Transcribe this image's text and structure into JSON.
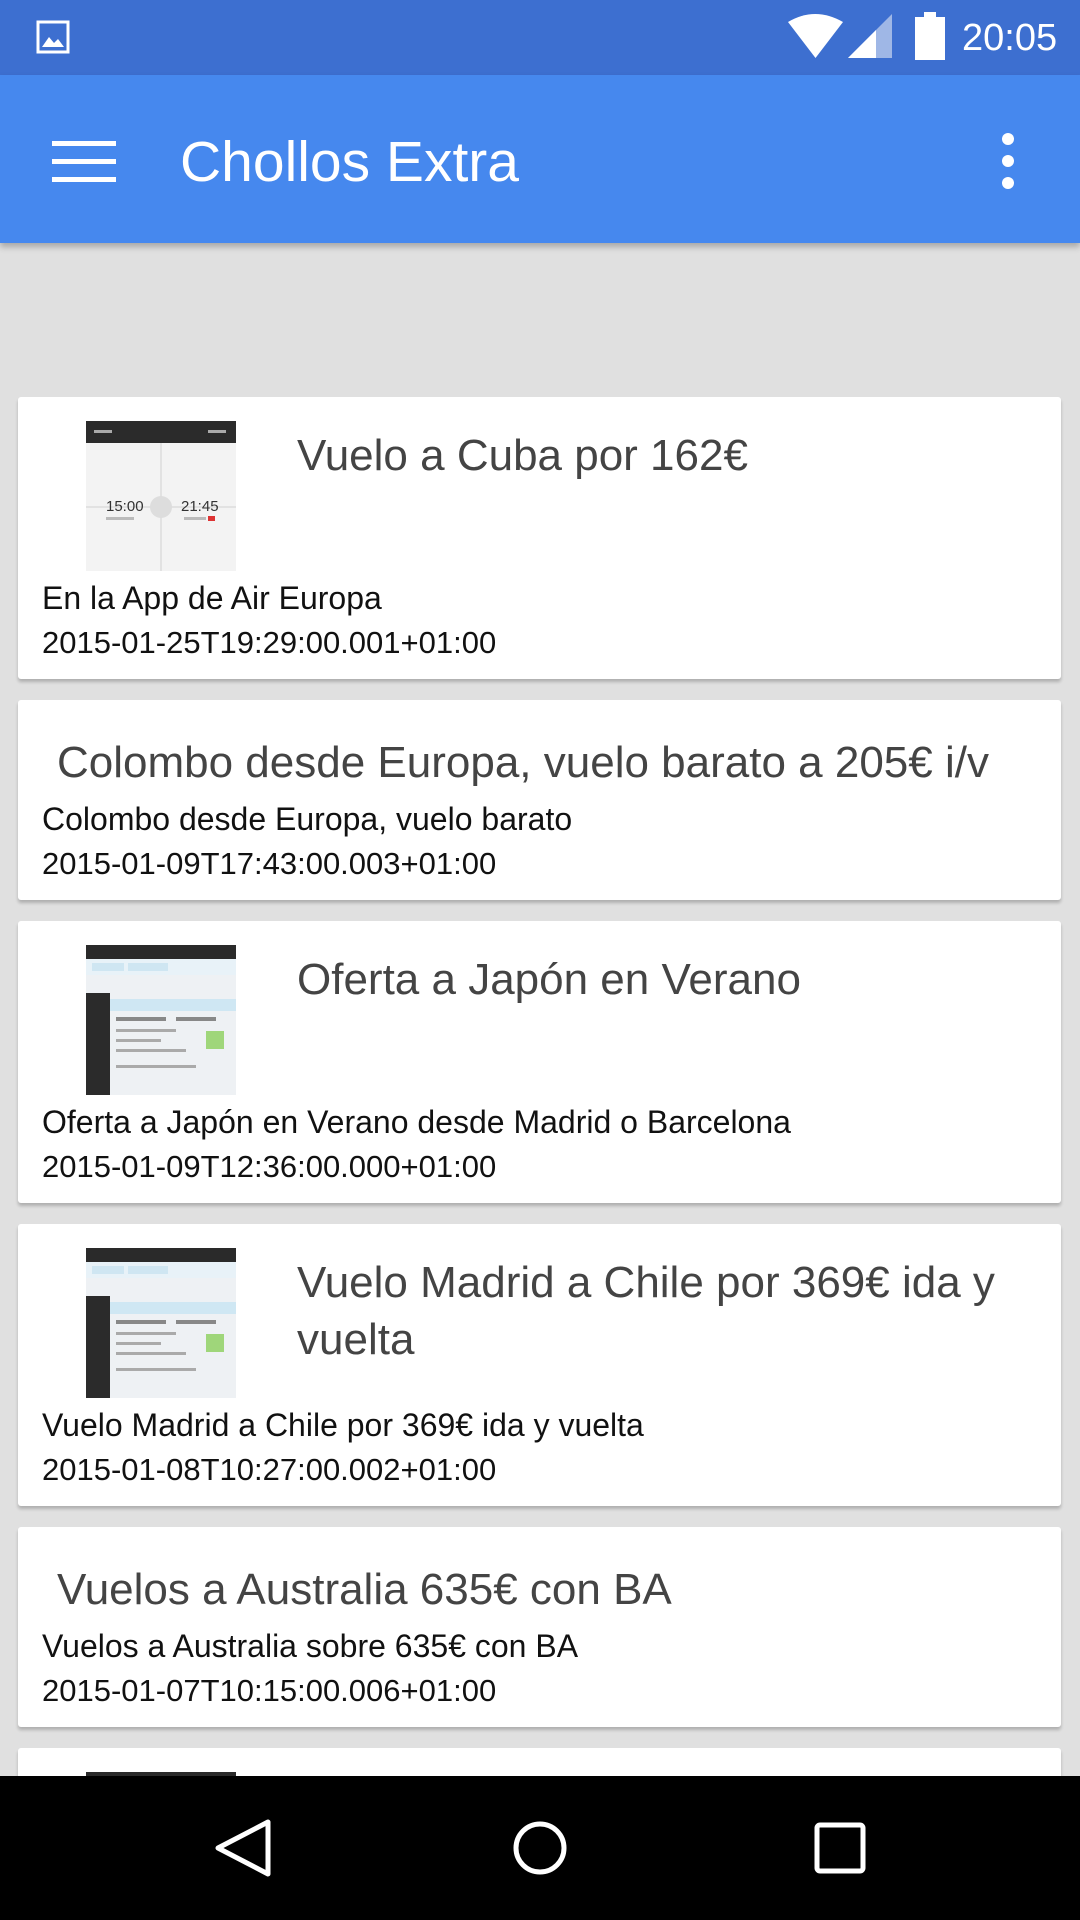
{
  "status_bar": {
    "time": "20:05",
    "icons": [
      "gallery-icon",
      "wifi-icon",
      "signal-icon",
      "battery-icon"
    ]
  },
  "app_bar": {
    "title": "Chollos Extra",
    "menu_icon": "hamburger-menu-icon",
    "overflow_icon": "more-vert-icon"
  },
  "colors": {
    "status_bar": "#3d6fd0",
    "app_bar": "#4688ee",
    "background": "#e0e0e0",
    "card": "#ffffff",
    "nav_bar": "#000000"
  },
  "cards": [
    {
      "title": "Vuelo a Cuba por 162€",
      "description": "En la App de Air Europa",
      "date": "2015-01-25T19:29:00.001+01:00",
      "has_thumbnail": true,
      "thumb_times": [
        "15:00",
        "21:45"
      ]
    },
    {
      "title": "Colombo desde Europa, vuelo barato a 205€ i/v",
      "description": "Colombo desde Europa, vuelo barato",
      "date": "2015-01-09T17:43:00.003+01:00",
      "has_thumbnail": false
    },
    {
      "title": "Oferta a Japón en Verano",
      "description": "Oferta a Japón en Verano desde Madrid o Barcelona",
      "date": "2015-01-09T12:36:00.000+01:00",
      "has_thumbnail": true
    },
    {
      "title_line1": "Vuelo Madrid a Chile por 369€ ida y",
      "title_line2": "vuelta",
      "description": "Vuelo Madrid a Chile por 369€ ida y vuelta",
      "date": "2015-01-08T10:27:00.002+01:00",
      "has_thumbnail": true
    },
    {
      "title": "Vuelos a Australia 635€ con BA",
      "description": "Vuelos a Australia sobre 635€ con BA",
      "date": "2015-01-07T10:15:00.006+01:00",
      "has_thumbnail": false
    }
  ],
  "nav_bar": {
    "icons": [
      "back-icon",
      "home-icon",
      "recents-icon"
    ]
  }
}
